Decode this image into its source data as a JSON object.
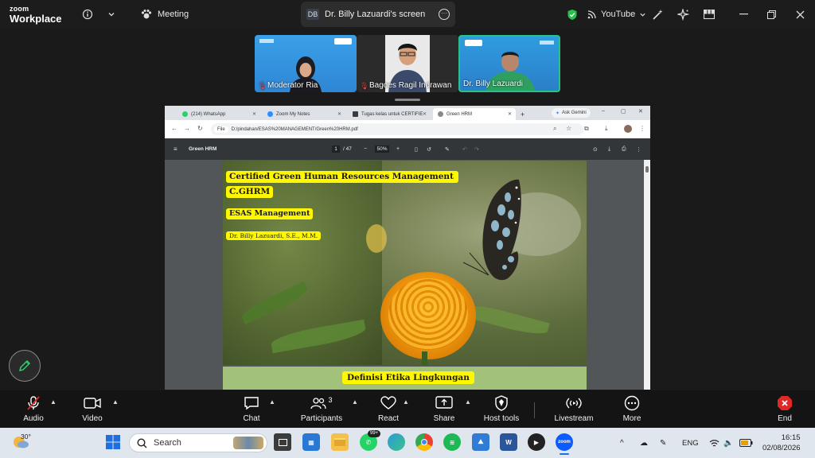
{
  "app": {
    "brand_line1": "zoom",
    "brand_line2": "Workplace",
    "meeting_label": "Meeting",
    "screen_badge": "DB",
    "screen_title": "Dr. Billy Lazuardi's screen",
    "youtube_label": "YouTube"
  },
  "participants": [
    {
      "name": "Moderator Ria",
      "muted": true
    },
    {
      "name": "Bagoes Ragil Indrawan",
      "muted": true
    },
    {
      "name": "Dr. Billy Lazuardi",
      "muted": false,
      "active_speaker": true
    }
  ],
  "browser": {
    "tabs": [
      {
        "label": "(214) WhatsApp",
        "favicon_color": "#25d366"
      },
      {
        "label": "Zoom My Notes",
        "favicon_color": "#2d8cff"
      },
      {
        "label": "Tugas kelas untuk CERTIFIE",
        "favicon_color": "#3b3b3b"
      },
      {
        "label": "Green HRM",
        "favicon_color": "#777777"
      }
    ],
    "ask_gemini": "Ask Gemini",
    "file_chip": "File",
    "url": "D:/pindahan/ESAS%20MANAGEMENT/Green%20HRM.pdf",
    "pdf_title": "Green HRM",
    "page_current": "1",
    "page_total": "/ 47",
    "zoom": "50%"
  },
  "slide": {
    "title_line1": "Certified Green Human Resources Management",
    "title_line2": "C.GHRM",
    "org": "ESAS  Management",
    "presenter": "Dr. Billy Lazuardi, S.E., M.M.",
    "next_slide_title": "Definisi Etika Lingkungan"
  },
  "toolbar": {
    "audio": "Audio",
    "video": "Video",
    "chat": "Chat",
    "participants": "Participants",
    "participants_count": "3",
    "react": "React",
    "share": "Share",
    "host_tools": "Host tools",
    "livestream": "Livestream",
    "more": "More",
    "end": "End"
  },
  "taskbar": {
    "temperature": "30°",
    "search_placeholder": "Search",
    "whatsapp_badge": "99+",
    "zoom_app_label": "zoom",
    "language": "ENG",
    "time": "16:15",
    "date": "02/08/2026"
  },
  "colors": {
    "active_speaker_border": "#25c28a",
    "slide_label_yellow": "#fff700",
    "end_red": "#e02828"
  }
}
